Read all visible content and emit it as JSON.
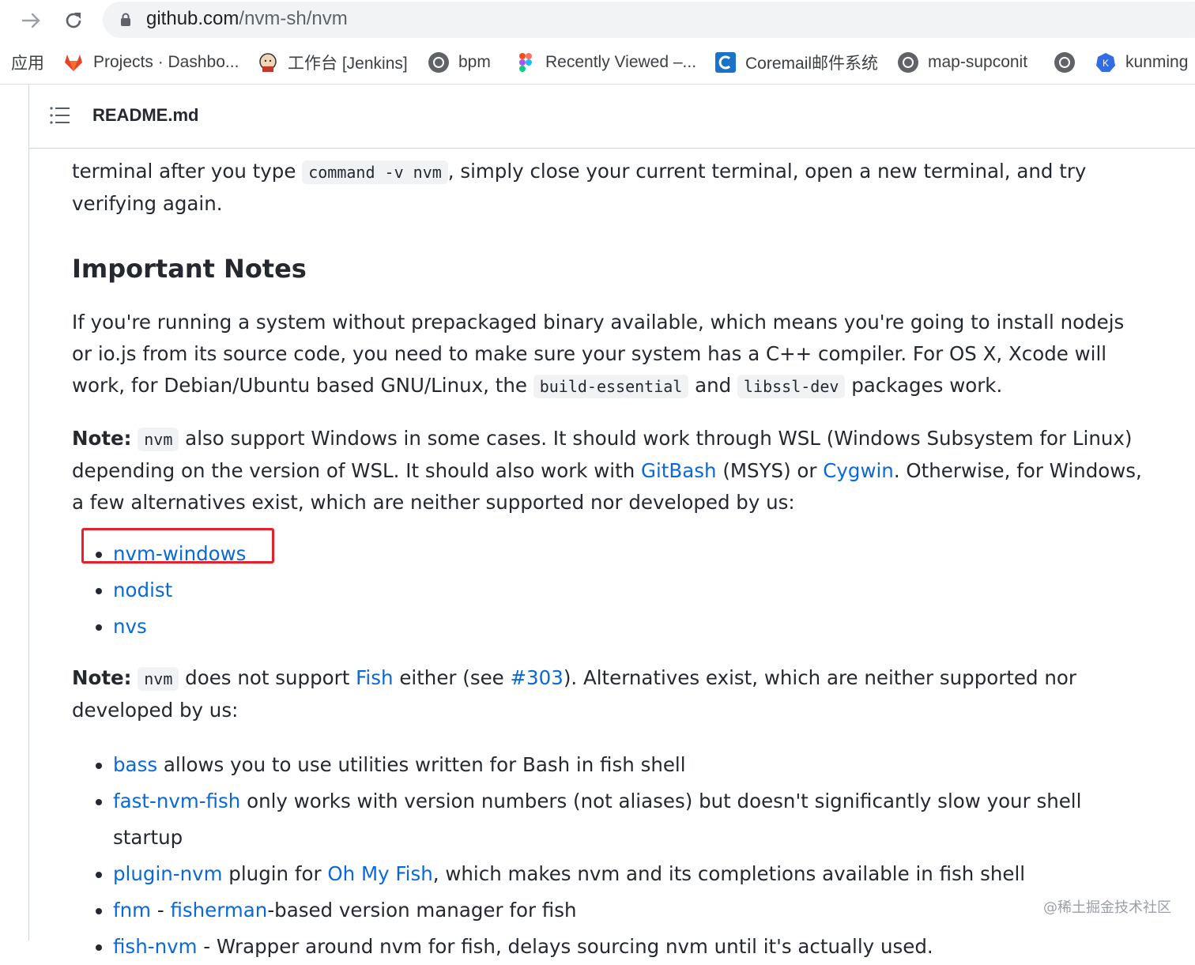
{
  "browser": {
    "url_host": "github.com",
    "url_path": "/nvm-sh/nvm",
    "bookmarks": [
      {
        "label": "应用",
        "icon": "apps-icon"
      },
      {
        "label": "Projects · Dashbo...",
        "icon": "gitlab-icon"
      },
      {
        "label": "工作台 [Jenkins]",
        "icon": "jenkins-icon"
      },
      {
        "label": "bpm",
        "icon": "globe-icon"
      },
      {
        "label": "Recently Viewed –...",
        "icon": "figma-icon"
      },
      {
        "label": "Coremail邮件系统",
        "icon": "coremail-icon"
      },
      {
        "label": "map-supconit",
        "icon": "globe-icon"
      },
      {
        "label": "",
        "icon": "globe-icon"
      },
      {
        "label": "kunming",
        "icon": "kubernetes-icon"
      }
    ]
  },
  "readme": {
    "title": "README.md",
    "intro": {
      "before": "terminal after you type ",
      "code": "command -v nvm",
      "after": ", simply close your current terminal, open a new terminal, and try verifying again."
    },
    "important_heading": "Important Notes",
    "important_para": {
      "t1": "If you're running a system without prepackaged binary available, which means you're going to install nodejs or io.js from its source code, you need to make sure your system has a C++ compiler. For OS X, Xcode will work, for Debian/Ubuntu based GNU/Linux, the ",
      "code1": "build-essential",
      "t2": " and ",
      "code2": "libssl-dev",
      "t3": " packages work."
    },
    "note1": {
      "label": "Note:",
      "code": "nvm",
      "t1": " also support Windows in some cases. It should work through WSL (Windows Subsystem for Linux) depending on the version of WSL. It should also work with ",
      "link1": "GitBash",
      "t2": " (MSYS) or ",
      "link2": "Cygwin",
      "t3": ". Otherwise, for Windows, a few alternatives exist, which are neither supported nor developed by us:"
    },
    "windows_alternatives": [
      "nvm-windows",
      "nodist",
      "nvs"
    ],
    "note2": {
      "label": "Note:",
      "code": "nvm",
      "t1": " does not support ",
      "link1": "Fish",
      "t2": " either (see ",
      "link2": "#303",
      "t3": "). Alternatives exist, which are neither supported nor developed by us:"
    },
    "fish_alternatives": [
      {
        "link": "bass",
        "text": " allows you to use utilities written for Bash in fish shell"
      },
      {
        "link": "fast-nvm-fish",
        "text": " only works with version numbers (not aliases) but doesn't significantly slow your shell startup"
      },
      {
        "link": "plugin-nvm",
        "text": " plugin for ",
        "link2": "Oh My Fish",
        "text2": ", which makes nvm and its completions available in fish shell"
      },
      {
        "link": "fnm",
        "text": " - ",
        "link2": "fisherman",
        "text2": "-based version manager for fish"
      },
      {
        "link": "fish-nvm",
        "text": " - Wrapper around nvm for fish, delays sourcing nvm until it's actually used."
      }
    ]
  },
  "watermark": "@稀土掘金技术社区",
  "colors": {
    "link": "#0969da",
    "highlight": "#e8202a",
    "text": "#24292f"
  }
}
